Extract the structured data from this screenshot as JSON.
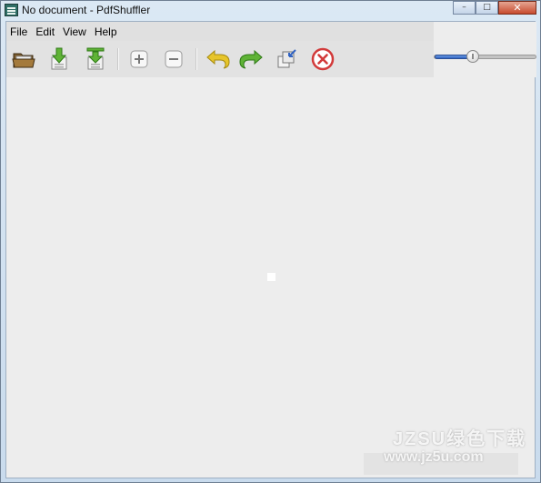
{
  "window": {
    "title": "No document - PdfShuffler",
    "app_icon": "pdfshuffler-app-icon",
    "controls": {
      "minimize_label": "–",
      "maximize_label": "□",
      "close_label": "✕"
    }
  },
  "menu": {
    "items": [
      {
        "label": "File"
      },
      {
        "label": "Edit"
      },
      {
        "label": "View"
      },
      {
        "label": "Help"
      }
    ]
  },
  "toolbar": {
    "buttons": [
      {
        "icon": "open-folder-icon"
      },
      {
        "icon": "save-icon"
      },
      {
        "icon": "save-as-icon"
      },
      {
        "icon": "zoom-in-icon"
      },
      {
        "icon": "zoom-out-icon"
      },
      {
        "icon": "rotate-left-icon"
      },
      {
        "icon": "rotate-right-icon"
      },
      {
        "icon": "crop-icon"
      },
      {
        "icon": "delete-icon"
      }
    ],
    "colors": {
      "green": "#5fb336",
      "yellow": "#e7c52a",
      "red": "#d23a3a",
      "blue": "#2f62c3"
    }
  },
  "zoom": {
    "level": 0.36
  },
  "watermark": {
    "line1": "JZSU绿色下载",
    "line2": "www.jz5u.com"
  }
}
